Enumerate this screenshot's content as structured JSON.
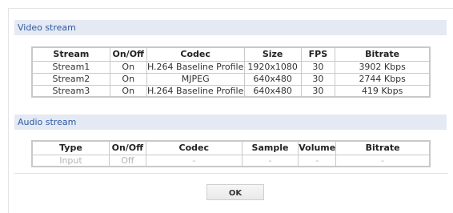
{
  "video": {
    "title": "Video stream",
    "headers": [
      "Stream",
      "On/Off",
      "Codec",
      "Size",
      "FPS",
      "Bitrate"
    ],
    "rows": [
      [
        "Stream1",
        "On",
        "H.264 Baseline Profile",
        "1920x1080",
        "30",
        "3902 Kbps"
      ],
      [
        "Stream2",
        "On",
        "MJPEG",
        "640x480",
        "30",
        "2744 Kbps"
      ],
      [
        "Stream3",
        "On",
        "H.264 Baseline Profile",
        "640x480",
        "30",
        "419 Kbps"
      ]
    ]
  },
  "audio": {
    "title": "Audio stream",
    "headers": [
      "Type",
      "On/Off",
      "Codec",
      "Sample",
      "Volume",
      "Bitrate"
    ],
    "rows": [
      [
        "Input",
        "Off",
        "-",
        "-",
        "-",
        "-"
      ]
    ]
  },
  "ok_label": "OK",
  "colors": {
    "header_bg": "#e4e9f4",
    "header_text": "#2d5aa0",
    "grid_border": "#c9c9c9",
    "muted_text": "#b4b4b4"
  }
}
